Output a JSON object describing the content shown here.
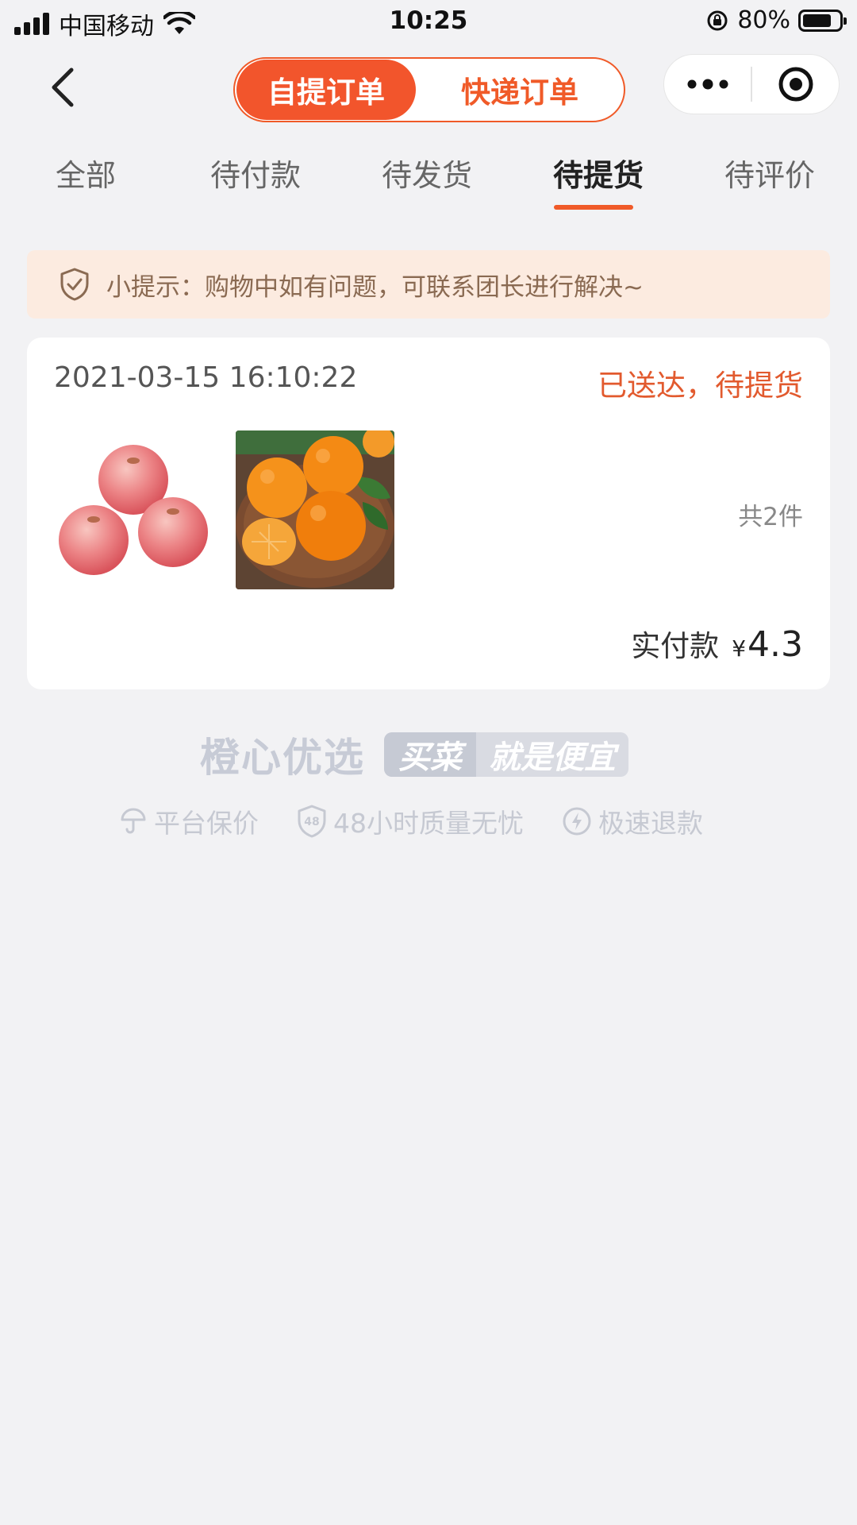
{
  "status_bar": {
    "carrier": "中国移动",
    "time": "10:25",
    "battery": "80%",
    "battery_level": 0.8
  },
  "nav": {
    "tabs": [
      {
        "label": "自提订单",
        "active": true
      },
      {
        "label": "快递订单",
        "active": false
      }
    ],
    "icons": [
      "back-arrow-icon",
      "more-icon",
      "close-target-icon"
    ]
  },
  "order_tabs": [
    {
      "label": "全部",
      "active": false
    },
    {
      "label": "待付款",
      "active": false
    },
    {
      "label": "待发货",
      "active": false
    },
    {
      "label": "待提货",
      "active": true
    },
    {
      "label": "待评价",
      "active": false
    }
  ],
  "notice": {
    "text": "小提示：购物中如有问题，可联系团长进行解决~"
  },
  "order": {
    "time": "2021-03-15 16:10:22",
    "status": "已送达，待提货",
    "products": [
      "apple",
      "orange"
    ],
    "count": "共2件",
    "pay_label": "实付款",
    "currency": "¥",
    "amount": "4.3"
  },
  "brand": {
    "name": "橙心优选",
    "slogan_a": "买菜",
    "slogan_b": "就是便宜",
    "guarantees": [
      "平台保价",
      "48小时质量无忧",
      "极速退款"
    ]
  },
  "colors": {
    "accent": "#f05a28",
    "background": "#f2f2f4",
    "notice_bg": "#fcebe0"
  }
}
